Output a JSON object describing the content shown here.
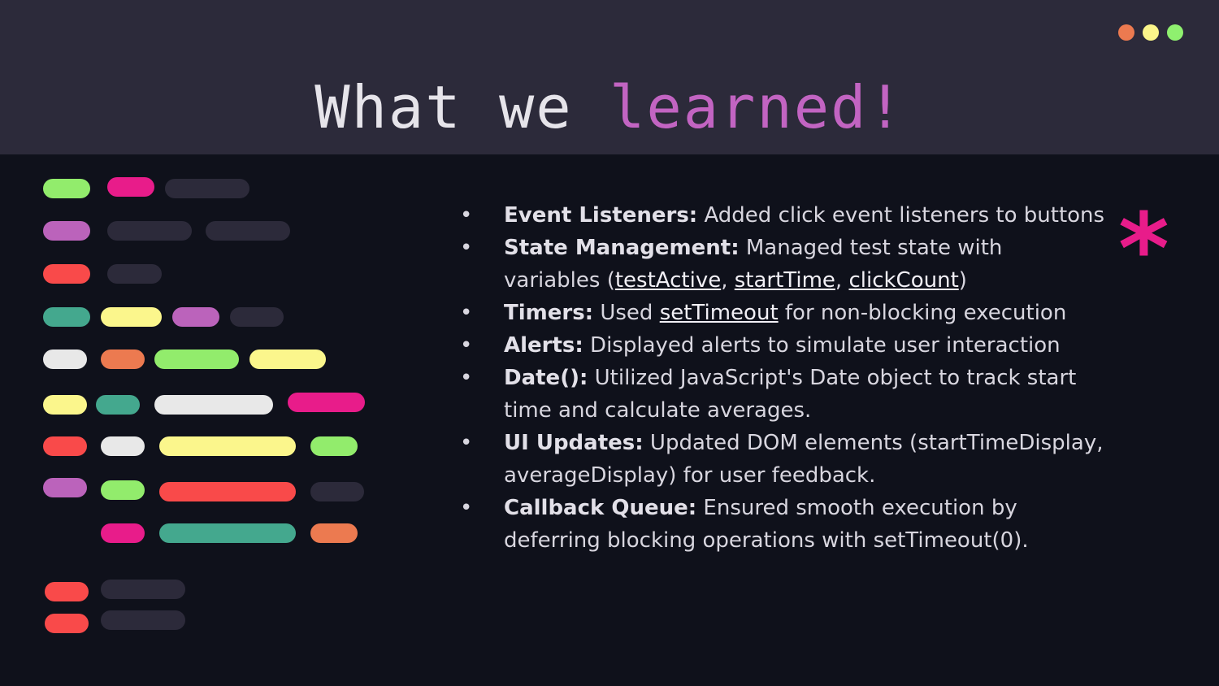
{
  "title": {
    "part1": "What we ",
    "part2": "learned!"
  },
  "window_dots": [
    "#ec7a50",
    "#fbf58a",
    "#8ff06f"
  ],
  "bullets": [
    {
      "bold": "Event Listeners:",
      "text": " Added click event listeners to buttons"
    },
    {
      "bold": "State Management:",
      "text": " Managed test state with variables (",
      "vars": [
        "testActive",
        "startTime",
        "clickCount"
      ],
      "tail": ")"
    },
    {
      "bold": "Timers:",
      "text": " Used ",
      "link": "setTimeout",
      "tail": " for non-blocking execution"
    },
    {
      "bold": "Alerts:",
      "text": " Displayed alerts to simulate user interaction"
    },
    {
      "bold": "Date():",
      "text": " Utilized JavaScript's Date object to track start time and calculate averages."
    },
    {
      "bold": "UI Updates:",
      "text": " Updated DOM elements (startTimeDisplay, averageDisplay) for user feedback."
    },
    {
      "bold": "Callback Queue:",
      "text": " Ensured smooth execution by deferring blocking operations with setTimeout(0)."
    }
  ],
  "bullet_glyph": "•",
  "asterisk": "*",
  "colors": {
    "green": "#92ec6c",
    "pink": "#e81c8a",
    "gray": "#2c2a3a",
    "purple": "#bb63bb",
    "red": "#f94a4a",
    "teal": "#44a88e",
    "yellow": "#fbf68c",
    "white": "#e8e8e8",
    "orange": "#ec7a50"
  }
}
